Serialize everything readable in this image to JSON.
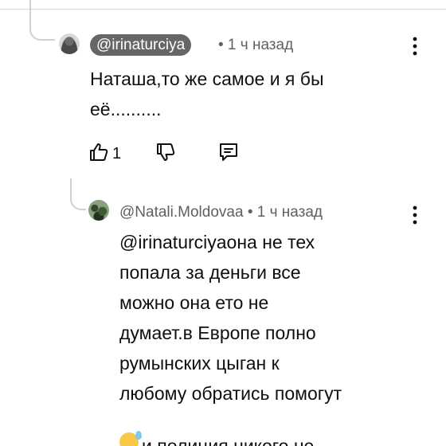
{
  "comments": [
    {
      "author": "@irinaturciya",
      "time": "• 1 ч назад",
      "text": "Наташа,то же самое и я бы\nеё..........",
      "likes": "1",
      "icons": {
        "like": "thumbs-up-icon",
        "dislike": "thumbs-down-icon",
        "reply": "reply-comment-icon",
        "menu": "more-vertical-icon"
      }
    },
    {
      "author": "@Natali.Moldovaa",
      "time": "• 1 ч назад",
      "text": "@irinaturciyaона не тех\nпопала за деньги все\nможно она ето не\nдумает.в Европе полно\nрумынских цыган к\nлюбому обратись помогут",
      "text_tail": "и полиция никого не",
      "emoji": "sweat-smile-emoji",
      "icons": {
        "menu": "more-vertical-icon"
      }
    }
  ],
  "colors": {
    "author_chip_bg": "#666666",
    "meta_text": "#606060",
    "body_text": "#0f0f0f",
    "thread_line": "#d0d0d0"
  }
}
